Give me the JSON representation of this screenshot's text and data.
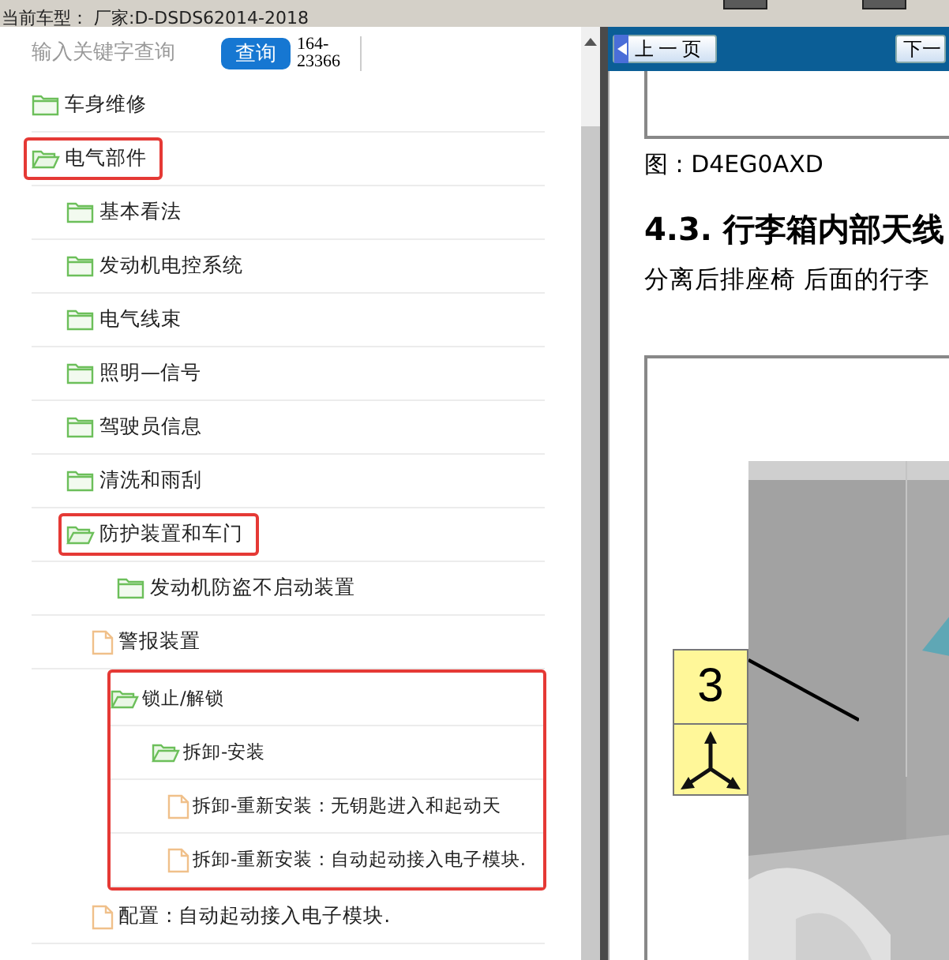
{
  "status_bar": {
    "vehicle_label": "当前车型：",
    "vehicle": "厂家:D-DSDS62014-2018"
  },
  "search": {
    "placeholder": "输入关键字查询",
    "button": "查询",
    "code_lines": [
      "164-",
      "23366"
    ]
  },
  "tree": [
    {
      "label": "车身维修",
      "kind": "folder",
      "expanded": false,
      "highlighted": false
    },
    {
      "label": "电气部件",
      "kind": "folder",
      "expanded": true,
      "highlighted": true,
      "children": [
        {
          "label": "基本看法",
          "kind": "folder",
          "expanded": false,
          "highlighted": false
        },
        {
          "label": "发动机电控系统",
          "kind": "folder",
          "expanded": false,
          "highlighted": false
        },
        {
          "label": "电气线束",
          "kind": "folder",
          "expanded": false,
          "highlighted": false
        },
        {
          "label": "照明—信号",
          "kind": "folder",
          "expanded": false,
          "highlighted": false
        },
        {
          "label": "驾驶员信息",
          "kind": "folder",
          "expanded": false,
          "highlighted": false
        },
        {
          "label": "清洗和雨刮",
          "kind": "folder",
          "expanded": false,
          "highlighted": false
        },
        {
          "label": "防护装置和车门",
          "kind": "folder",
          "expanded": true,
          "highlighted": true,
          "children": [
            {
              "label": "发动机防盗不启动装置",
              "kind": "folder",
              "expanded": false,
              "highlighted": false
            },
            {
              "label": "警报装置",
              "kind": "document",
              "highlighted": false
            },
            {
              "label": "锁止/解锁",
              "kind": "folder",
              "expanded": true,
              "highlighted": true,
              "highlight_includes_children": true,
              "children": [
                {
                  "label": "拆卸-安装",
                  "kind": "folder",
                  "expanded": true,
                  "children": [
                    {
                      "label": "拆卸-重新安装 : 无钥匙进入和起动天",
                      "kind": "document"
                    },
                    {
                      "label": "拆卸-重新安装 : 自动起动接入电子模块.",
                      "kind": "document"
                    }
                  ]
                }
              ]
            },
            {
              "label": "配置 : 自动起动接入电子模块.",
              "kind": "document",
              "highlighted": false
            }
          ]
        }
      ]
    }
  ],
  "document": {
    "nav": [
      {
        "label": "上一页",
        "kind": "previous"
      },
      {
        "label": "下一",
        "kind": "next"
      }
    ],
    "figure_caption": "图 : D4EG0AXD",
    "heading": "4.3. 行李箱内部天线",
    "paragraph": "分离后排座椅 后面的行李",
    "callout": {
      "number": "3"
    }
  }
}
